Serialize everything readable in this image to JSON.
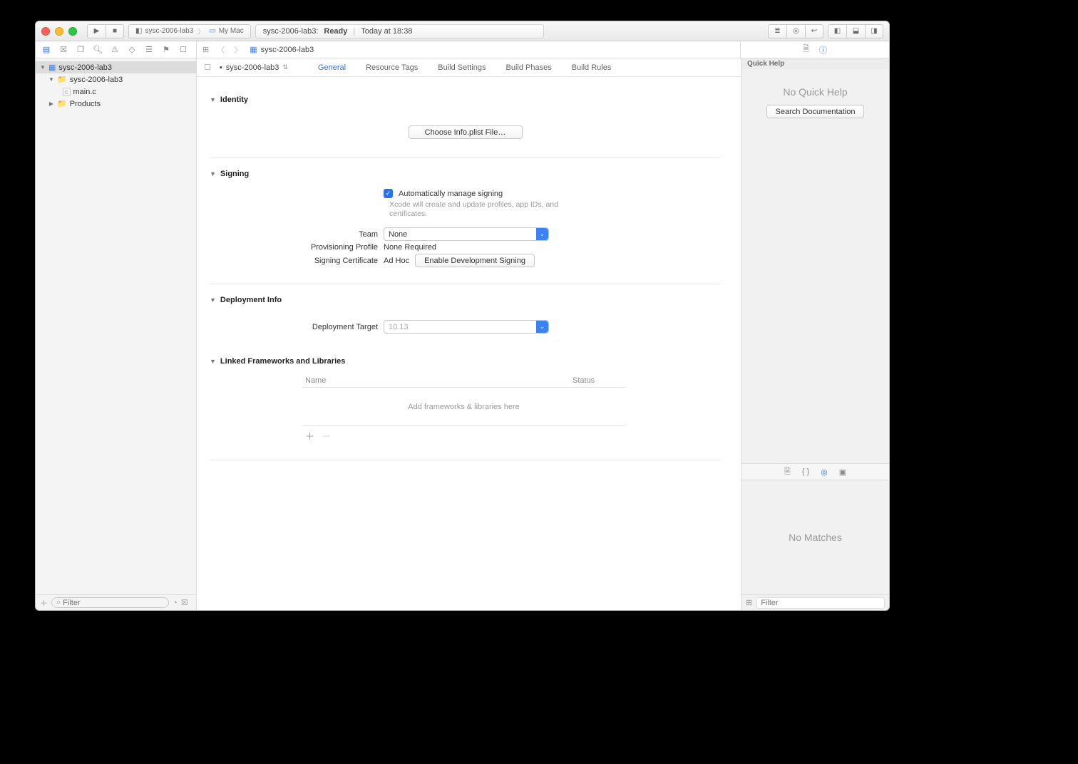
{
  "titlebar": {
    "scheme": "sysc-2006-lab3",
    "destination": "My Mac",
    "status_name": "sysc-2006-lab3:",
    "status_state": "Ready",
    "status_time": "Today at 18:38"
  },
  "navstrip": {
    "breadcrumb": "sysc-2006-lab3"
  },
  "sidebar": {
    "project": "sysc-2006-lab3",
    "group": "sysc-2006-lab3",
    "file": "main.c",
    "products": "Products",
    "filter_placeholder": "Filter"
  },
  "targetbar": {
    "target": "sysc-2006-lab3",
    "tabs": [
      "General",
      "Resource Tags",
      "Build Settings",
      "Build Phases",
      "Build Rules"
    ]
  },
  "sections": {
    "identity": {
      "title": "Identity",
      "choose_btn": "Choose Info.plist File…"
    },
    "signing": {
      "title": "Signing",
      "auto_label": "Automatically manage signing",
      "auto_help": "Xcode will create and update profiles, app IDs, and certificates.",
      "team_label": "Team",
      "team_value": "None",
      "profile_label": "Provisioning Profile",
      "profile_value": "None Required",
      "cert_label": "Signing Certificate",
      "cert_value": "Ad Hoc",
      "enable_btn": "Enable Development Signing"
    },
    "deploy": {
      "title": "Deployment Info",
      "target_label": "Deployment Target",
      "target_value": "10.13"
    },
    "frameworks": {
      "title": "Linked Frameworks and Libraries",
      "col_name": "Name",
      "col_status": "Status",
      "empty": "Add frameworks & libraries here"
    }
  },
  "inspector": {
    "qh_title": "Quick Help",
    "no_qh": "No Quick Help",
    "search_docs": "Search Documentation",
    "no_matches": "No Matches",
    "filter_placeholder": "Filter"
  }
}
